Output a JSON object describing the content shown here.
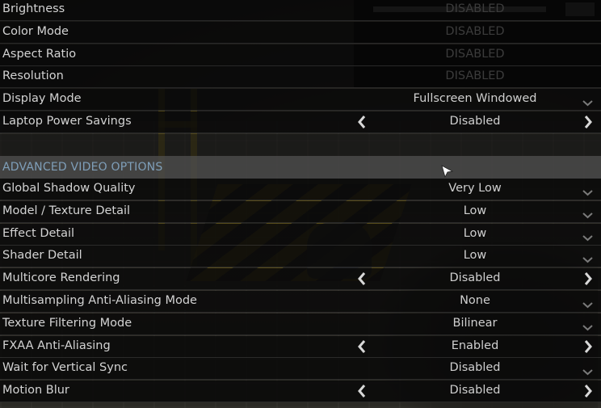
{
  "basic": [
    {
      "label": "Brightness",
      "value": "DISABLED",
      "control": "slider-disabled"
    },
    {
      "label": "Color Mode",
      "value": "DISABLED",
      "control": "disabled"
    },
    {
      "label": "Aspect Ratio",
      "value": "DISABLED",
      "control": "disabled"
    },
    {
      "label": "Resolution",
      "value": "DISABLED",
      "control": "disabled"
    },
    {
      "label": "Display Mode",
      "value": "Fullscreen Windowed",
      "control": "dropdown"
    },
    {
      "label": "Laptop Power Savings",
      "value": "Disabled",
      "control": "toggle"
    }
  ],
  "advanced": {
    "title": "ADVANCED VIDEO OPTIONS",
    "rows": [
      {
        "label": "Global Shadow Quality",
        "value": "Very Low",
        "control": "dropdown"
      },
      {
        "label": "Model / Texture Detail",
        "value": "Low",
        "control": "dropdown"
      },
      {
        "label": "Effect Detail",
        "value": "Low",
        "control": "dropdown"
      },
      {
        "label": "Shader Detail",
        "value": "Low",
        "control": "dropdown"
      },
      {
        "label": "Multicore Rendering",
        "value": "Disabled",
        "control": "toggle"
      },
      {
        "label": "Multisampling Anti-Aliasing Mode",
        "value": "None",
        "control": "dropdown"
      },
      {
        "label": "Texture Filtering Mode",
        "value": "Bilinear",
        "control": "dropdown"
      },
      {
        "label": "FXAA Anti-Aliasing",
        "value": "Enabled",
        "control": "toggle"
      },
      {
        "label": "Wait for Vertical Sync",
        "value": "Disabled",
        "control": "dropdown"
      },
      {
        "label": "Motion Blur",
        "value": "Disabled",
        "control": "toggle"
      }
    ]
  },
  "icons": {
    "dropdown": "chevron-down-icon",
    "toggle_left": "arrow-left-icon",
    "toggle_right": "arrow-right-icon",
    "cursor": "mouse-cursor-icon"
  },
  "colors": {
    "section_title": "#7f9fb9",
    "label_text": "#d3d3d3",
    "disabled_text": "#3c3c3c"
  }
}
